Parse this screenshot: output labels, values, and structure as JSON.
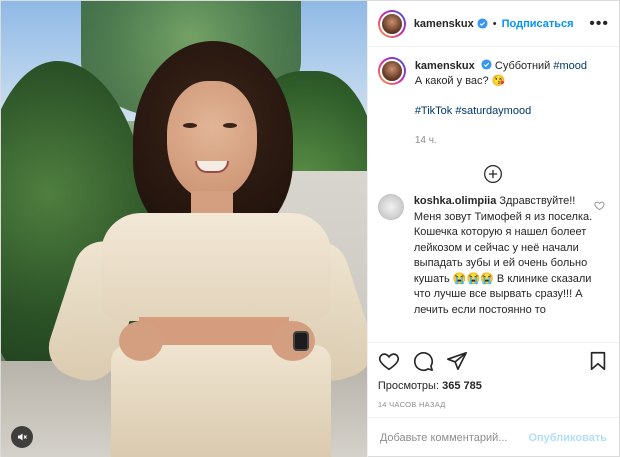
{
  "post": {
    "author": "kamenskux",
    "follow_label": "Подписаться",
    "separator": "•",
    "more_label": "•••"
  },
  "caption": {
    "username": "kamenskux",
    "text_line1": "Субботний",
    "hashtag_mood": "#mood",
    "text_line2": "А какой у вас? 😘",
    "hashtags_tiktok": "#TikTok",
    "hashtags_saturday": "#saturdaymood",
    "time": "14 ч."
  },
  "comment": {
    "username": "koshka.olimpiia",
    "text": "Здравствуйте!! Меня зовут Тимофей я из поселка. Кошечка которую я нашел болеет лейкозом и сейчас у неё начали выпадать зубы и ей очень больно кушать 😭😭😭 В клинике сказали что лучше все вырвать сразу!!! А лечить если постоянно то",
    "text_tail": "…"
  },
  "stats": {
    "views_label": "Просмотры:",
    "views_value": "365 785",
    "timestamp": "14 ЧАСОВ НАЗАД"
  },
  "compose": {
    "placeholder": "Добавьте комментарий...",
    "publish_label": "Опубликовать"
  },
  "icons": {
    "verified": "verified-badge-icon",
    "heart": "heart-icon",
    "comment": "comment-icon",
    "share": "share-icon",
    "save": "bookmark-icon",
    "mute": "mute-icon",
    "load_more": "plus-circle-icon",
    "emoji": "smile-icon"
  },
  "colors": {
    "accent": "#0095f6",
    "verified": "#3897f0",
    "muted_text": "#8e8e8e",
    "publish_disabled": "#b2dffc",
    "hashtag": "#00376b"
  }
}
